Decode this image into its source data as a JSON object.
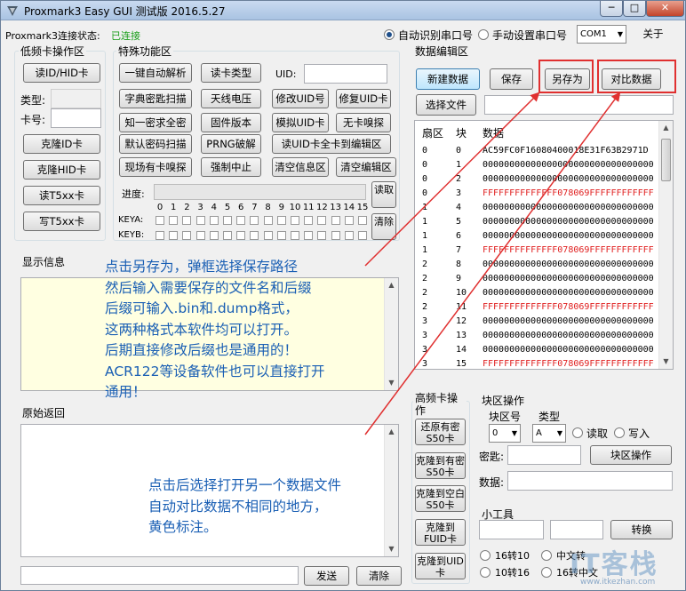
{
  "window": {
    "title": "Proxmark3 Easy GUI 测试版 2016.5.27",
    "min": "─",
    "max": "□",
    "close": "✕"
  },
  "connection": {
    "label": "Proxmark3连接状态:",
    "status": "已连接",
    "status_color": "#1a9e1a",
    "auto_port": "自动识别串口号",
    "manual_port": "手动设置串口号",
    "port": "COM1",
    "about": "关于"
  },
  "lf": {
    "title": "低频卡操作区",
    "read_id": "读ID/HID卡",
    "type_label": "类型:",
    "card_label": "卡号:",
    "clone_id": "克隆ID卡",
    "clone_hid": "克隆HID卡",
    "read_t5": "读T5xx卡",
    "write_t5": "写T5xx卡"
  },
  "special": {
    "title": "特殊功能区",
    "buttons": [
      "一键自动解析",
      "读卡类型",
      "字典密匙扫描",
      "天线电压",
      "修改UID号",
      "修复UID卡",
      "知一密求全密",
      "固件版本",
      "模拟UID卡",
      "无卡嗅探",
      "默认密码扫描",
      "PRNG破解",
      "读UID卡全卡到编辑区",
      "现场有卡嗅探",
      "强制中止",
      "清空信息区",
      "清空编辑区"
    ],
    "uid_label": "UID:",
    "progress_label": "进度:",
    "progress": 0,
    "read_btn": "读取",
    "clear_btn": "清除",
    "keya": "KEYA:",
    "keyb": "KEYB:",
    "bits": [
      "0",
      "1",
      "2",
      "3",
      "4",
      "5",
      "6",
      "7",
      "8",
      "9",
      "10",
      "11",
      "12",
      "13",
      "14",
      "15"
    ]
  },
  "editor": {
    "title": "数据编辑区",
    "new_data": "新建数据",
    "save": "保存",
    "save_as": "另存为",
    "compare": "对比数据",
    "select_file": "选择文件",
    "columns": [
      "扇区",
      "块",
      "数据"
    ],
    "rows": [
      {
        "sector": "0",
        "block": "0",
        "data": "AC59FC0F16080400018E31F63B2971D",
        "red": false
      },
      {
        "sector": "0",
        "block": "1",
        "data": "00000000000000000000000000000000",
        "red": false
      },
      {
        "sector": "0",
        "block": "2",
        "data": "00000000000000000000000000000000",
        "red": false
      },
      {
        "sector": "0",
        "block": "3",
        "data": "FFFFFFFFFFFFFF078069FFFFFFFFFFFF",
        "red": true
      },
      {
        "sector": "1",
        "block": "4",
        "data": "00000000000000000000000000000000",
        "red": false
      },
      {
        "sector": "1",
        "block": "5",
        "data": "00000000000000000000000000000000",
        "red": false
      },
      {
        "sector": "1",
        "block": "6",
        "data": "00000000000000000000000000000000",
        "red": false
      },
      {
        "sector": "1",
        "block": "7",
        "data": "FFFFFFFFFFFFFF078069FFFFFFFFFFFF",
        "red": true
      },
      {
        "sector": "2",
        "block": "8",
        "data": "00000000000000000000000000000000",
        "red": false
      },
      {
        "sector": "2",
        "block": "9",
        "data": "00000000000000000000000000000000",
        "red": false
      },
      {
        "sector": "2",
        "block": "10",
        "data": "00000000000000000000000000000000",
        "red": false
      },
      {
        "sector": "2",
        "block": "11",
        "data": "FFFFFFFFFFFFFF078069FFFFFFFFFFFF",
        "red": true
      },
      {
        "sector": "3",
        "block": "12",
        "data": "00000000000000000000000000000000",
        "red": false
      },
      {
        "sector": "3",
        "block": "13",
        "data": "00000000000000000000000000000000",
        "red": false
      },
      {
        "sector": "3",
        "block": "14",
        "data": "00000000000000000000000000000000",
        "red": false
      },
      {
        "sector": "3",
        "block": "15",
        "data": "FFFFFFFFFFFFFF078069FFFFFFFFFFFF",
        "red": true
      }
    ]
  },
  "info": {
    "title": "显示信息"
  },
  "raw": {
    "title": "原始返回",
    "send": "发送",
    "clear": "清除"
  },
  "hf": {
    "title": "高频卡操作",
    "restore": "还原有密S50卡",
    "clone_pwd": "克隆到有密S50卡",
    "clone_blank": "克隆到空白S50卡",
    "clone_fuid": "克隆到FUID卡",
    "clone_uid": "克隆到UID卡"
  },
  "block": {
    "title": "块区操作",
    "block_no_label": "块区号",
    "type_label": "类型",
    "block_no": "0",
    "type": "A",
    "read": "读取",
    "write": "写入",
    "key_label": "密匙:",
    "data_label": "数据:",
    "op_btn": "块区操作"
  },
  "tools": {
    "title": "小工具",
    "convert": "转换",
    "r1": "16转10",
    "r2": "中文转",
    "r3": "10转16",
    "r4": "16转中文"
  },
  "annotations": {
    "save_as": [
      "点击另存为，弹框选择保存路径",
      "然后输入需要保存的文件名和后缀",
      "后缀可输入.bin和.dump格式，",
      "这两种格式本软件均可以打开。",
      "后期直接修改后缀也是通用的！",
      "ACR122等设备软件也可以直接打开",
      "通用！"
    ],
    "compare": [
      "点击后选择打开另一个数据文件",
      "自动对比数据不相同的地方，",
      "黄色标注。"
    ],
    "color": "#1a5fb4",
    "arrow_color": "#e03030"
  },
  "watermark": {
    "text": "IT客栈",
    "sub": "www.itkezhan.com"
  }
}
